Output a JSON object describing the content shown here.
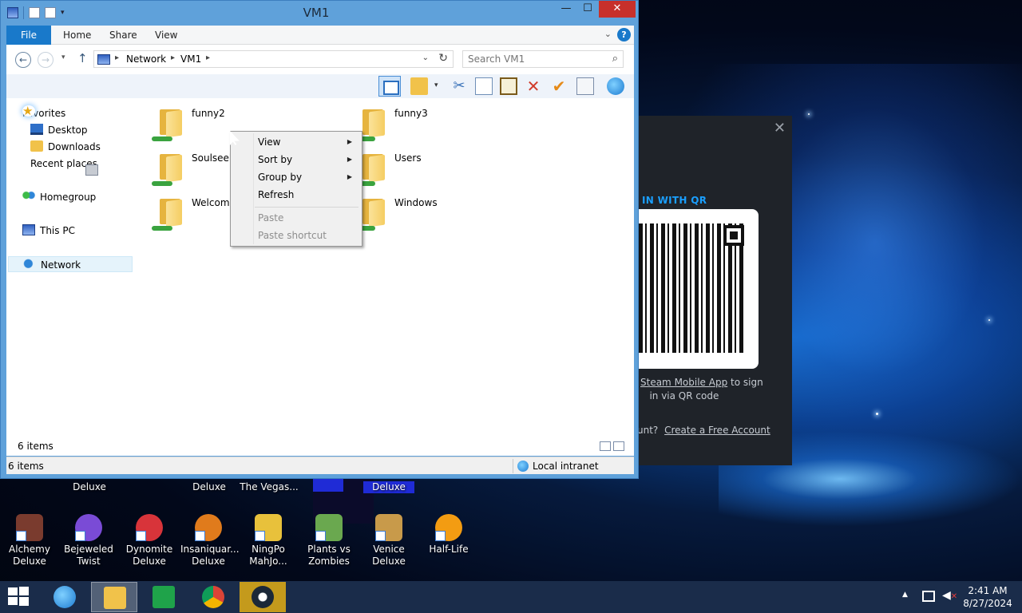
{
  "window": {
    "title": "VM1",
    "controls": {
      "minimize": "—",
      "maximize": "☐",
      "close": "✕"
    }
  },
  "ribbon": {
    "file": "File",
    "tabs": [
      "Home",
      "Share",
      "View"
    ]
  },
  "address": {
    "crumbs": [
      "Network",
      "VM1"
    ],
    "search_placeholder": "Search VM1"
  },
  "nav": {
    "favorites": "Favorites",
    "desktop": "Desktop",
    "downloads": "Downloads",
    "recent": "Recent places",
    "homegroup": "Homegroup",
    "this_pc": "This PC",
    "network": "Network"
  },
  "folders": [
    {
      "name": "funny2"
    },
    {
      "name": "funny3"
    },
    {
      "name": "SoulseekC"
    },
    {
      "name": "Users"
    },
    {
      "name": "Welcome"
    },
    {
      "name": "Windows"
    }
  ],
  "context_menu": {
    "view": "View",
    "sort_by": "Sort by",
    "group_by": "Group by",
    "refresh": "Refresh",
    "paste": "Paste",
    "paste_shortcut": "Paste shortcut"
  },
  "status": {
    "inner_count": "6 items",
    "count": "6 items",
    "zone": "Local intranet"
  },
  "steam": {
    "qr_title": "IN WITH QR",
    "hint_link": "Steam Mobile App",
    "hint_rest1": " to sign",
    "hint_rest2": "in via QR code",
    "acct_prefix": "unt?",
    "acct_link": "Create a Free Account"
  },
  "desktop_top_row": [
    "Deluxe",
    "Deluxe",
    "The Vegas...",
    "Deluxe"
  ],
  "desktop_icons": [
    {
      "label1": "Alchemy",
      "label2": "Deluxe",
      "color": "#7a3b2e"
    },
    {
      "label1": "Bejeweled",
      "label2": "Twist",
      "color": "#7a4bd6"
    },
    {
      "label1": "Dynomite",
      "label2": "Deluxe",
      "color": "#d8343a"
    },
    {
      "label1": "Insaniquar...",
      "label2": "Deluxe",
      "color": "#e07b1c"
    },
    {
      "label1": "NingPo",
      "label2": "MahJo...",
      "color": "#e8c13b"
    },
    {
      "label1": "Plants vs",
      "label2": "Zombies",
      "color": "#6aa84f"
    },
    {
      "label1": "Venice",
      "label2": "Deluxe",
      "color": "#c89a4a"
    },
    {
      "label1": "Half-Life",
      "label2": "",
      "color": "#f39c12"
    }
  ],
  "clock": {
    "time": "2:41 AM",
    "date": "8/27/2024"
  }
}
